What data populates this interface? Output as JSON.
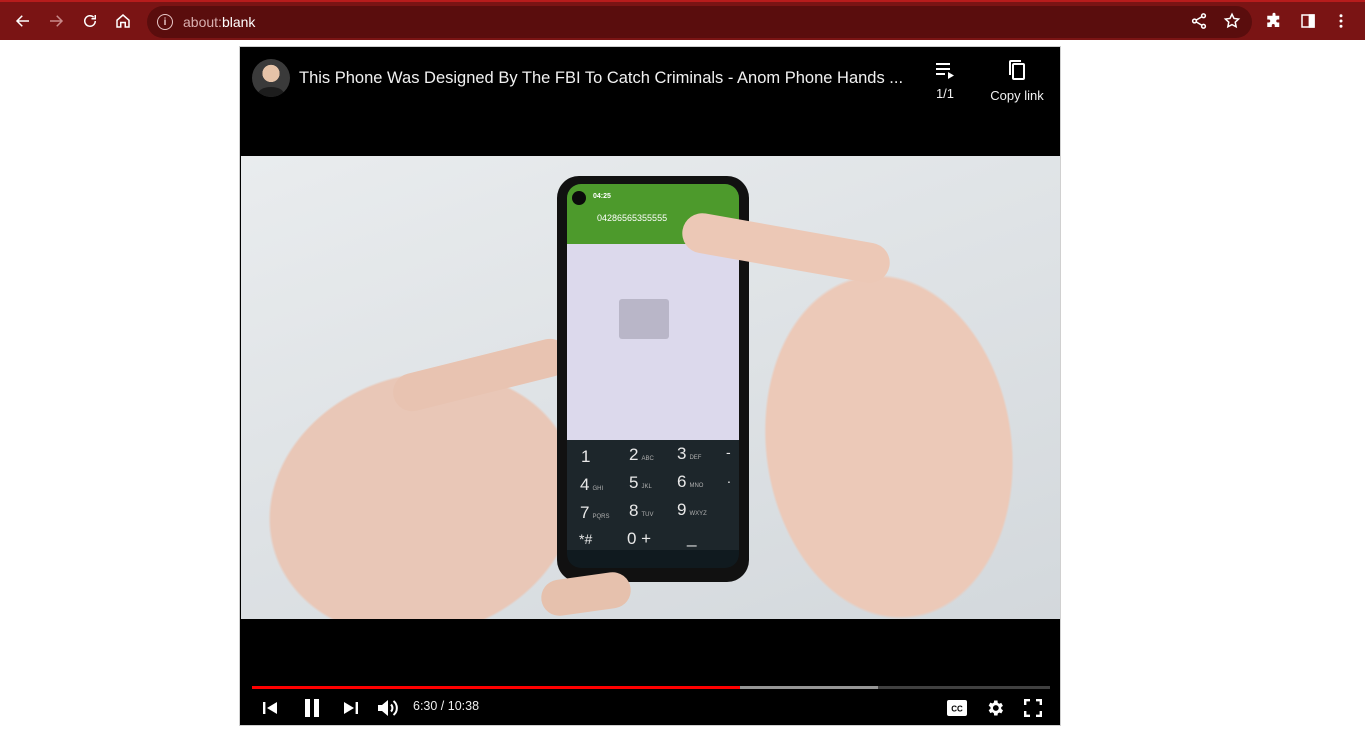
{
  "browser": {
    "url_scheme": "about:",
    "url_path": "blank",
    "icons": [
      "back-icon",
      "forward-icon",
      "reload-icon",
      "home-icon",
      "info-icon",
      "share-icon",
      "star-icon",
      "extensions-icon",
      "side-panel-icon",
      "menu-icon"
    ],
    "accent": "#7a1414"
  },
  "player": {
    "title": "This Phone Was Designed By The FBI To Catch Criminals - Anom Phone Hands ...",
    "playlist_count": "1/1",
    "copy_link_label": "Copy link",
    "time_display": "6:30 / 10:38",
    "progress_played_fraction": 0.611,
    "progress_buffered_fraction": 0.784,
    "progress_color": "#ff0000"
  },
  "video_frame": {
    "phone_clock": "04:25",
    "phone_number": "04286565355555",
    "keys": [
      {
        "digit": "1",
        "letters": ""
      },
      {
        "digit": "2",
        "letters": "ABC"
      },
      {
        "digit": "3",
        "letters": "DEF"
      },
      {
        "digit": "-",
        "letters": ""
      },
      {
        "digit": "4",
        "letters": "GHI"
      },
      {
        "digit": "5",
        "letters": "JKL"
      },
      {
        "digit": "6",
        "letters": "MNO"
      },
      {
        "digit": ".",
        "letters": ""
      },
      {
        "digit": "7",
        "letters": "PQRS"
      },
      {
        "digit": "8",
        "letters": "TUV"
      },
      {
        "digit": "9",
        "letters": "WXYZ"
      },
      {
        "digit": "*#",
        "letters": ""
      },
      {
        "digit": "0 +",
        "letters": ""
      },
      {
        "digit": "_",
        "letters": ""
      }
    ]
  }
}
